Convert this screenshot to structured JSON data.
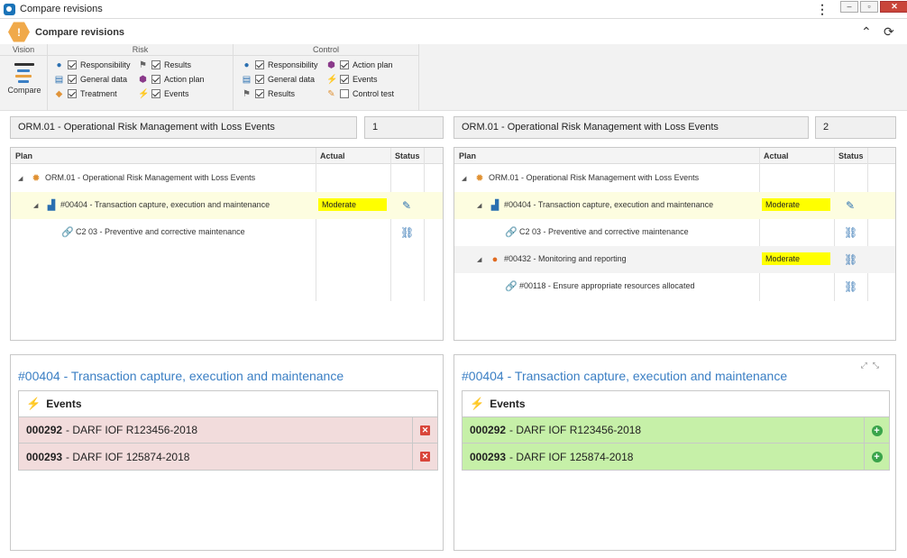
{
  "window": {
    "title": "Compare revisions"
  },
  "header": {
    "title": "Compare revisions"
  },
  "ribbon": {
    "groups": {
      "vision": "Vision",
      "risk": "Risk",
      "control": "Control"
    },
    "compare_label": "Compare",
    "risk_options": [
      {
        "label": "Responsibility",
        "checked": true,
        "icon": "user-icon"
      },
      {
        "label": "General data",
        "checked": true,
        "icon": "document-icon"
      },
      {
        "label": "Treatment",
        "checked": true,
        "icon": "bandage-icon"
      },
      {
        "label": "Results",
        "checked": true,
        "icon": "flag-icon"
      },
      {
        "label": "Action plan",
        "checked": true,
        "icon": "cube-icon"
      },
      {
        "label": "Events",
        "checked": true,
        "icon": "bolt-icon"
      }
    ],
    "control_options": [
      {
        "label": "Responsibility",
        "checked": true,
        "icon": "user-icon"
      },
      {
        "label": "General data",
        "checked": true,
        "icon": "document-icon"
      },
      {
        "label": "Results",
        "checked": true,
        "icon": "flag-icon"
      },
      {
        "label": "Action plan",
        "checked": true,
        "icon": "cube-icon"
      },
      {
        "label": "Events",
        "checked": true,
        "icon": "bolt-icon"
      },
      {
        "label": "Control test",
        "checked": false,
        "icon": "test-icon"
      }
    ]
  },
  "left": {
    "plan_name": "ORM.01 - Operational Risk Management with Loss Events",
    "revision": "1",
    "columns": {
      "plan": "Plan",
      "actual": "Actual",
      "status": "Status"
    },
    "rows": [
      {
        "text": "ORM.01 - Operational Risk Management with Loss Events",
        "actual": "",
        "status": ""
      },
      {
        "text": "#00404 - Transaction capture, execution and maintenance",
        "actual": "Moderate",
        "status": "edit"
      },
      {
        "text": "C2 03 - Preventive and corrective maintenance",
        "actual": "",
        "status": "link-alert"
      }
    ],
    "detail": {
      "title": "#00404 - Transaction capture, execution and maintenance",
      "events_label": "Events",
      "events": [
        {
          "code": "000292",
          "desc": "- DARF IOF R123456-2018"
        },
        {
          "code": "000293",
          "desc": "- DARF IOF 125874-2018"
        }
      ]
    }
  },
  "right": {
    "plan_name": "ORM.01 - Operational Risk Management with Loss Events",
    "revision": "2",
    "columns": {
      "plan": "Plan",
      "actual": "Actual",
      "status": "Status"
    },
    "rows": [
      {
        "text": "ORM.01 - Operational Risk Management with Loss Events",
        "actual": "",
        "status": ""
      },
      {
        "text": "#00404 - Transaction capture, execution and maintenance",
        "actual": "Moderate",
        "status": "edit"
      },
      {
        "text": "C2 03 - Preventive and corrective maintenance",
        "actual": "",
        "status": "link-alert"
      },
      {
        "text": "#00432 - Monitoring and reporting",
        "actual": "Moderate",
        "status": "link-alert"
      },
      {
        "text": "#00118 - Ensure appropriate resources allocated",
        "actual": "",
        "status": "link-alert"
      }
    ],
    "detail": {
      "title": "#00404 - Transaction capture, execution and maintenance",
      "events_label": "Events",
      "events": [
        {
          "code": "000292",
          "desc": "- DARF IOF R123456-2018"
        },
        {
          "code": "000293",
          "desc": "- DARF IOF 125874-2018"
        }
      ]
    }
  },
  "colors": {
    "accent": "#3b7fc4",
    "highlight": "#ffff00",
    "removed": "#f2dcdc",
    "added": "#c6f0a8"
  }
}
